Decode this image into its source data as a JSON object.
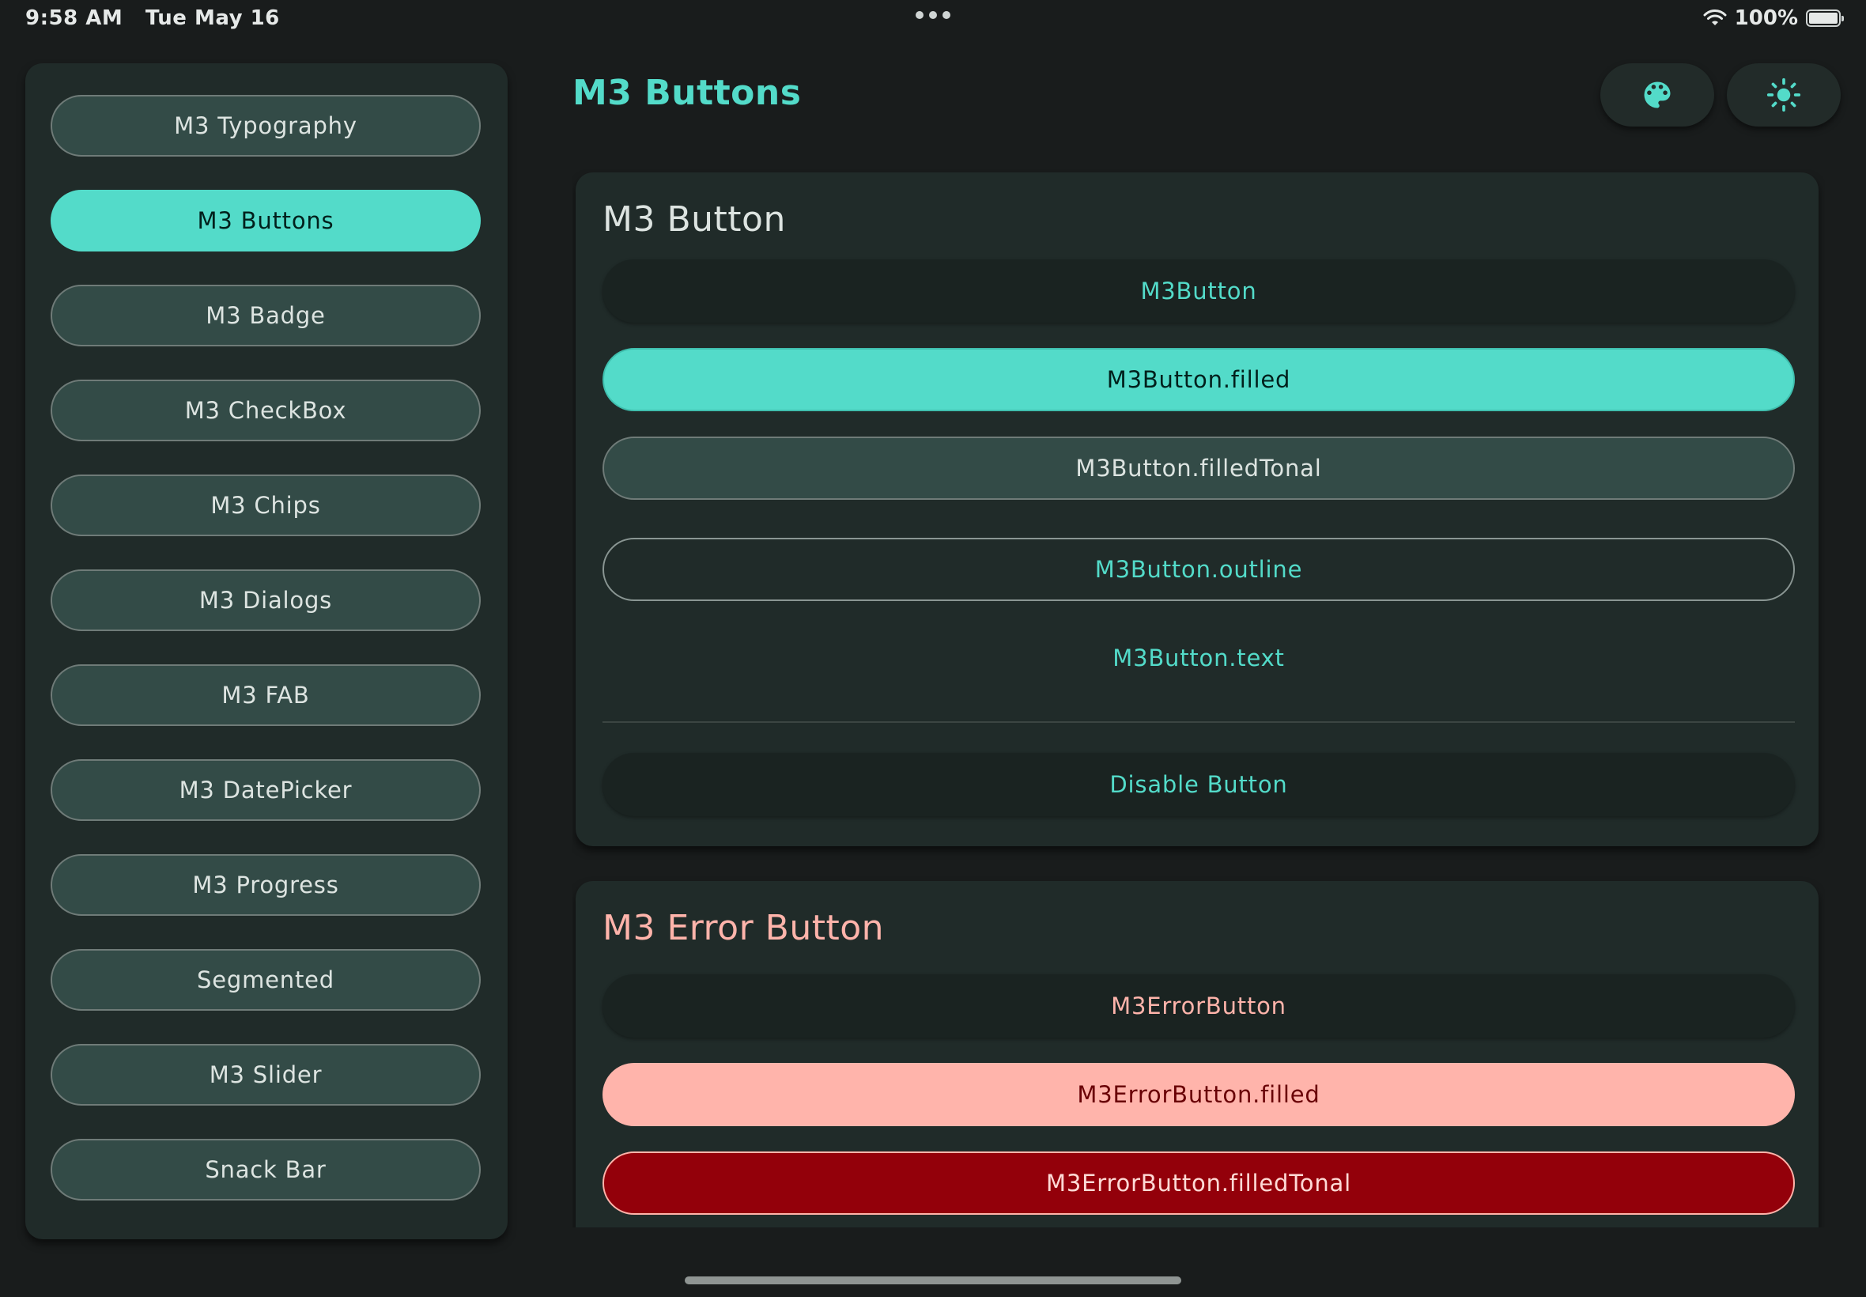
{
  "status_bar": {
    "time": "9:58 AM",
    "date": "Tue May 16",
    "battery": "100%"
  },
  "sidebar": {
    "items": [
      {
        "label": "M3 Typography",
        "active": false
      },
      {
        "label": "M3 Buttons",
        "active": true
      },
      {
        "label": "M3 Badge",
        "active": false
      },
      {
        "label": "M3 CheckBox",
        "active": false
      },
      {
        "label": "M3 Chips",
        "active": false
      },
      {
        "label": "M3 Dialogs",
        "active": false
      },
      {
        "label": "M3 FAB",
        "active": false
      },
      {
        "label": "M3 DatePicker",
        "active": false
      },
      {
        "label": "M3 Progress",
        "active": false
      },
      {
        "label": "Segmented",
        "active": false
      },
      {
        "label": "M3 Slider",
        "active": false
      },
      {
        "label": "Snack Bar",
        "active": false
      }
    ]
  },
  "header": {
    "title": "M3 Buttons",
    "actions": [
      {
        "icon": "palette-icon"
      },
      {
        "icon": "sun-icon"
      }
    ]
  },
  "button_section": {
    "title": "M3 Button",
    "buttons": {
      "elevated": "M3Button",
      "filled": "M3Button.filled",
      "filled_tonal": "M3Button.filledTonal",
      "outline": "M3Button.outline",
      "text": "M3Button.text"
    },
    "disable_button": "Disable Button"
  },
  "error_section": {
    "title": "M3 Error Button",
    "buttons": {
      "elevated": "M3ErrorButton",
      "filled": "M3ErrorButton.filled",
      "filled_tonal": "M3ErrorButton.filledTonal"
    }
  },
  "colors": {
    "primary": "#53dbc9",
    "background": "#191c1c",
    "surface": "#202b29",
    "secondary_container": "#334b47",
    "error": "#ffb4ab",
    "error_container": "#93000a"
  }
}
